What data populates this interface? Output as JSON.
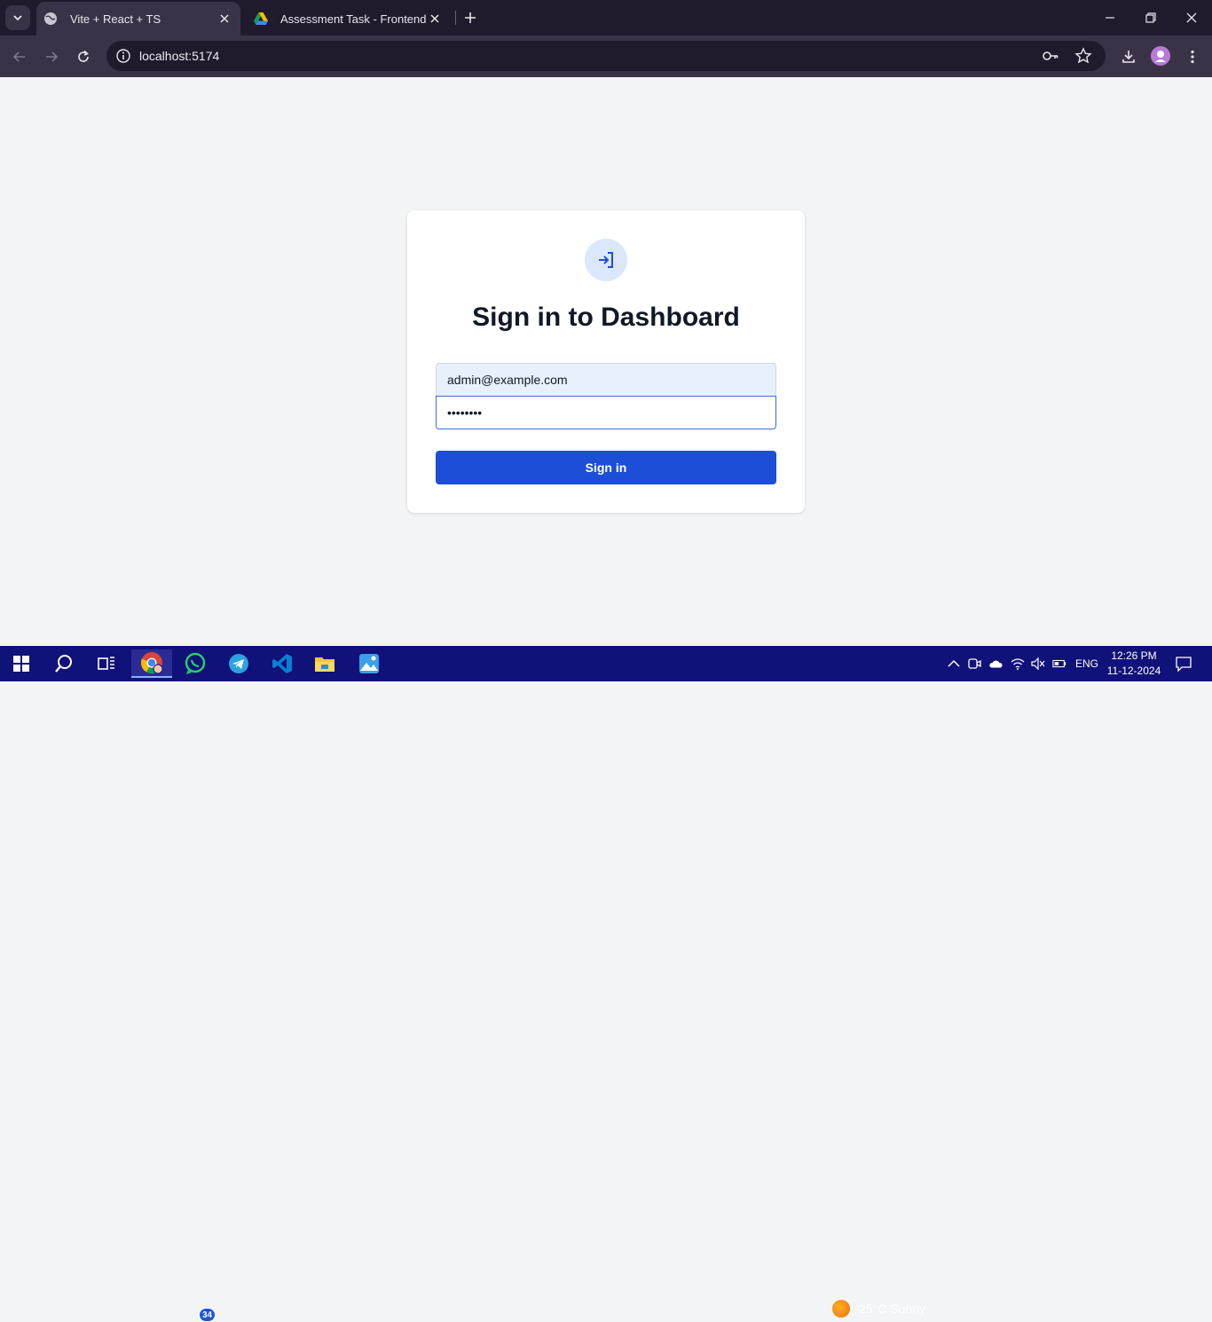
{
  "browser": {
    "tabs": [
      {
        "title": "Vite + React + TS",
        "favicon": "globe-icon",
        "active": true
      },
      {
        "title": "Assessment Task - Frontend De",
        "favicon": "google-drive-icon",
        "active": false
      }
    ],
    "address": "localhost:5174"
  },
  "login": {
    "icon": "sign-in-icon",
    "title": "Sign in to Dashboard",
    "email_value": "admin@example.com",
    "password_value": "••••••••",
    "submit_label": "Sign in"
  },
  "taskbar": {
    "apps": [
      "windows-start-icon",
      "search-icon",
      "task-view-icon",
      "chrome-icon",
      "whatsapp-icon",
      "telegram-icon",
      "vscode-icon",
      "file-explorer-icon",
      "photos-icon"
    ],
    "whatsapp_badge": "34",
    "weather": "25°C  Sunny",
    "language": "ENG",
    "time": "12:26 PM",
    "date": "11-12-2024"
  },
  "colors": {
    "primary_button": "#1d4ed8",
    "page_background": "#f3f4f6",
    "taskbar": "#11117a"
  }
}
